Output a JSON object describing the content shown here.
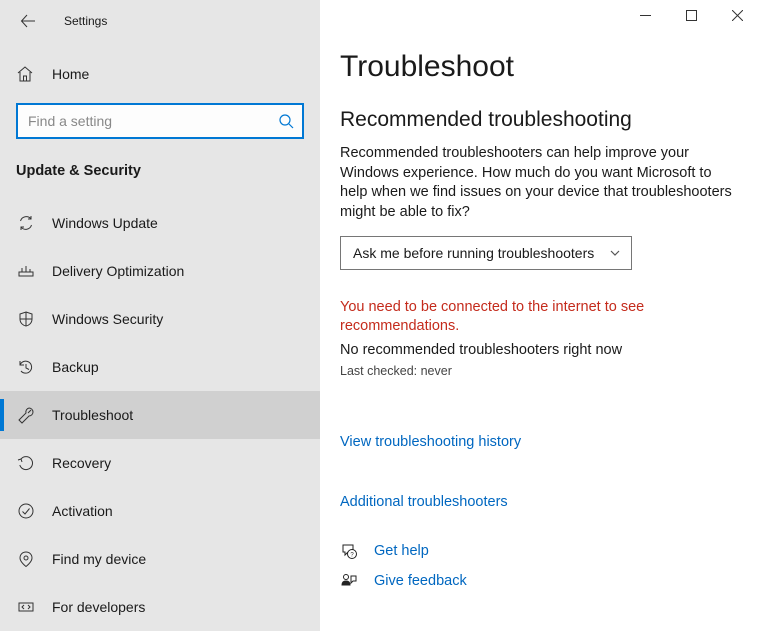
{
  "header": {
    "title": "Settings"
  },
  "sidebar": {
    "home_label": "Home",
    "search_placeholder": "Find a setting",
    "category": "Update & Security",
    "items": [
      {
        "label": "Windows Update"
      },
      {
        "label": "Delivery Optimization"
      },
      {
        "label": "Windows Security"
      },
      {
        "label": "Backup"
      },
      {
        "label": "Troubleshoot"
      },
      {
        "label": "Recovery"
      },
      {
        "label": "Activation"
      },
      {
        "label": "Find my device"
      },
      {
        "label": "For developers"
      }
    ]
  },
  "main": {
    "page_title": "Troubleshoot",
    "section_heading": "Recommended troubleshooting",
    "description": "Recommended troubleshooters can help improve your Windows experience. How much do you want Microsoft to help when we find issues on your device that troubleshooters might be able to fix?",
    "dropdown_value": "Ask me before running troubleshooters",
    "error_text": "You need to be connected to the internet to see recommendations.",
    "status_line": "No recommended troubleshooters right now",
    "last_checked": "Last checked: never",
    "history_link": "View troubleshooting history",
    "additional_link": "Additional troubleshooters",
    "help_link": "Get help",
    "feedback_link": "Give feedback"
  }
}
